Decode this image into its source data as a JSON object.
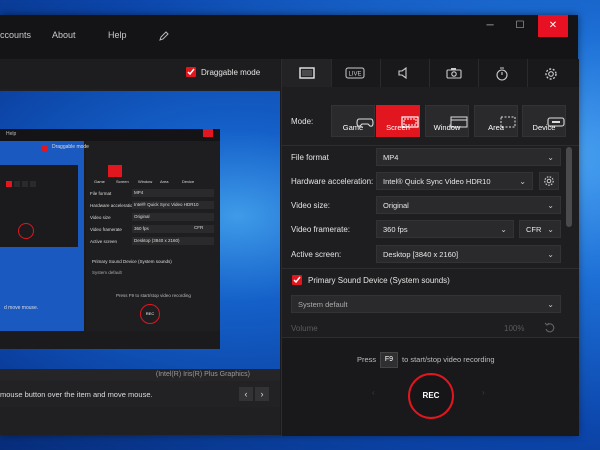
{
  "menu": {
    "accounts": "ccounts",
    "about": "About",
    "help": "Help"
  },
  "window": {
    "minimize": "─",
    "maximize": "☐",
    "close": "✕"
  },
  "left": {
    "draggable_label": "Draggable mode",
    "gpu_label": "(Intel(R) Iris(R) Plus Graphics)",
    "hint_text": "mouse button over the item and move mouse.",
    "prev_label": "‹",
    "next_label": "›",
    "mini": {
      "help": "Help",
      "draggable": "Draggable mode",
      "modes": [
        "Game",
        "Screen",
        "Window",
        "Area",
        "Device"
      ],
      "rows": [
        {
          "label": "File format",
          "value": "MP4"
        },
        {
          "label": "Hardware acceleration",
          "value": "Intel® Quick Sync Video HDR10"
        },
        {
          "label": "Video size",
          "value": "Original"
        },
        {
          "label": "Video framerate",
          "value": "360 fps",
          "extra": "CFR"
        },
        {
          "label": "Active screen",
          "value": "Desktop (3840 x 2160)"
        }
      ],
      "sound": "Primary Sound Device (System sounds)",
      "sound_default": "System default",
      "press": "Press",
      "key": "F9",
      "hint": "to start/stop video recording",
      "rec": "REC",
      "inner_hint": "d move mouse."
    }
  },
  "tabs": [
    "screen",
    "live",
    "audio",
    "webcam",
    "timer",
    "settings"
  ],
  "tab_live_text": "LIVE",
  "mode_label": "Mode:",
  "modes": [
    {
      "label": "Game",
      "active": false
    },
    {
      "label": "Screen",
      "active": true
    },
    {
      "label": "Window",
      "active": false
    },
    {
      "label": "Area",
      "active": false
    },
    {
      "label": "Device",
      "active": false
    }
  ],
  "settings": {
    "file_format": {
      "label": "File format",
      "value": "MP4"
    },
    "hw_accel": {
      "label": "Hardware acceleration:",
      "value": "Intel® Quick Sync Video HDR10"
    },
    "video_size": {
      "label": "Video size:",
      "value": "Original"
    },
    "framerate": {
      "label": "Video framerate:",
      "value": "360 fps",
      "mode": "CFR"
    },
    "active_screen": {
      "label": "Active screen:",
      "value": "Desktop [3840 x 2160]"
    }
  },
  "audio": {
    "device": "Primary Sound Device (System sounds)",
    "selection": "System default",
    "volume_label": "Volume",
    "volume_value": "100%"
  },
  "recording": {
    "press": "Press",
    "key": "F9",
    "hint": "to start/stop video recording",
    "rec": "REC"
  },
  "colors": {
    "accent": "#e2161f",
    "panel": "#1e1e20",
    "title": "#141416"
  }
}
